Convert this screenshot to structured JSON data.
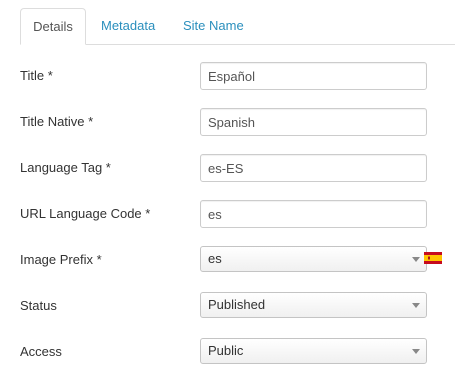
{
  "tabs": {
    "details": "Details",
    "metadata": "Metadata",
    "site_name": "Site Name"
  },
  "form": {
    "title": {
      "label": "Title *",
      "value": "Español"
    },
    "title_native": {
      "label": "Title Native *",
      "value": "Spanish"
    },
    "language_tag": {
      "label": "Language Tag *",
      "value": "es-ES"
    },
    "url_code": {
      "label": "URL Language Code *",
      "value": "es"
    },
    "image_prefix": {
      "label": "Image Prefix *",
      "value": "es",
      "flag_icon": "spain-flag-icon"
    },
    "status": {
      "label": "Status",
      "value": "Published"
    },
    "access": {
      "label": "Access",
      "value": "Public"
    }
  },
  "colors": {
    "tab_link": "#2a8fbd",
    "field_border": "#cccccc",
    "label_text": "#333333"
  }
}
